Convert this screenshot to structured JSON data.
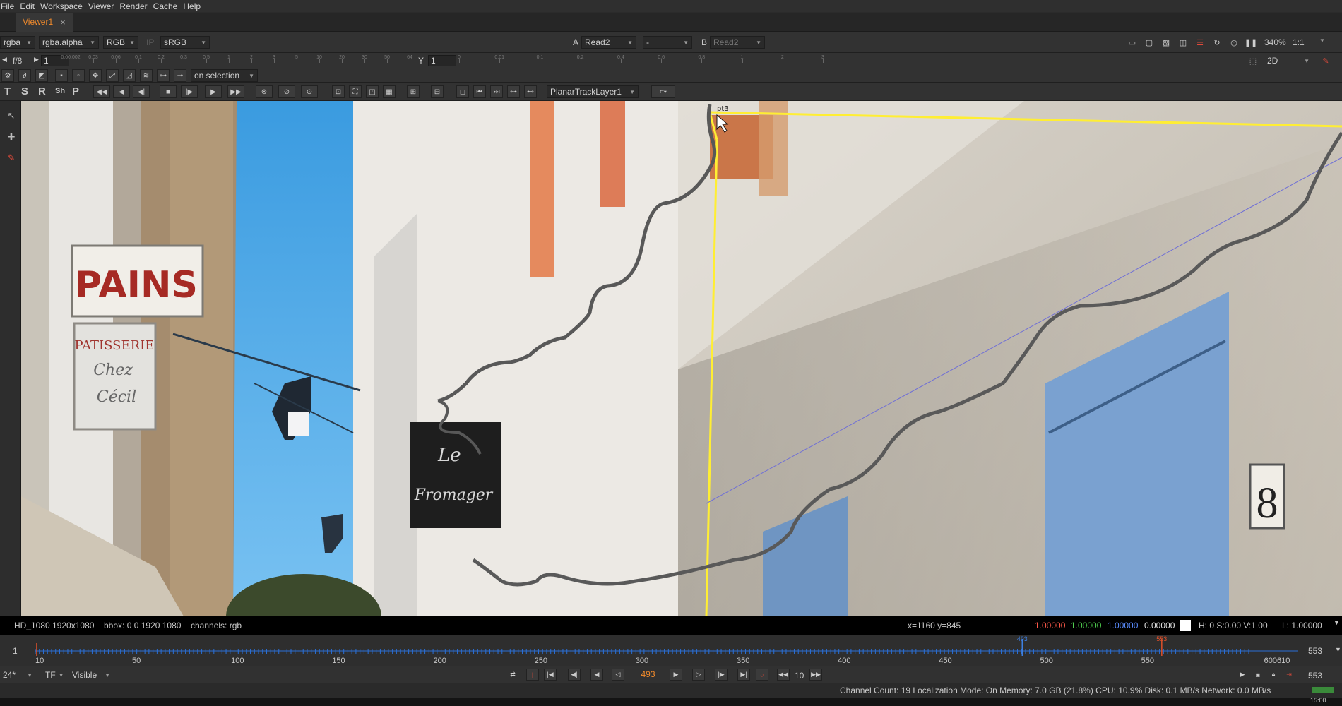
{
  "menu": [
    "File",
    "Edit",
    "Workspace",
    "Viewer",
    "Render",
    "Cache",
    "Help"
  ],
  "tab": {
    "label": "Viewer1",
    "close": "×"
  },
  "viewer_controls": {
    "channels": "rgba",
    "alpha_channel": "rgba.alpha",
    "display_channels": "RGB",
    "ip_label": "IP",
    "colorspace": "sRGB",
    "input_a_label": "A",
    "input_a": "Read2",
    "blend_mode": "-",
    "input_b_label": "B",
    "input_b": "Read2",
    "zoom": "340%",
    "proxy_ratio": "1:1"
  },
  "gain_gamma": {
    "fstop": "f/8",
    "gain_value": "1",
    "gain_ticks": [
      "0.00.002",
      "0.03",
      "0.06",
      "0.1",
      "0.2",
      "0.3",
      "0.5",
      "1",
      "2",
      "3",
      "5",
      "10",
      "20",
      "30",
      "50",
      "64"
    ],
    "gamma_label": "Y",
    "gamma_value": "1",
    "gamma_ticks": [
      "0",
      "0.01",
      "0.1",
      "0.2",
      "0.4",
      "0.6",
      "0.8",
      "1",
      "2",
      "3"
    ],
    "view_mode": "2D"
  },
  "tracker_toolbar": {
    "tool_letters": [
      "T",
      "S",
      "R",
      "Sh",
      "P"
    ],
    "update_mode": "on selection",
    "layer": "PlanarTrackLayer1"
  },
  "scene": {
    "sign_pains": "PAINS",
    "sign_patisserie": "PATISSERIE",
    "sign_chez": "Chez",
    "sign_cecil": "Cécil",
    "sign_le": "Le",
    "sign_fromager": "Fromager",
    "house_number": "8",
    "point_label": "pt3"
  },
  "info_bar": {
    "format": "HD_1080 1920x1080",
    "bbox": "bbox: 0 0 1920 1080",
    "channels": "channels: rgb",
    "coords": "x=1160 y=845",
    "r": "1.00000",
    "g": "1.00000",
    "b": "1.00000",
    "a": "0.00000",
    "hsv": "H:  0 S:0.00 V:1.00",
    "luminance": "L: 1.00000"
  },
  "timeline": {
    "start": "1",
    "end": "553",
    "range_start": "10",
    "range_end": "610",
    "ticks": [
      "10",
      "50",
      "100",
      "150",
      "200",
      "250",
      "300",
      "350",
      "400",
      "450",
      "500",
      "550",
      "600"
    ],
    "current_frame_marker": "493",
    "out_marker": "553",
    "current_fraction": 0.8133,
    "out_fraction": 0.9283
  },
  "playback": {
    "fps": "24*",
    "tf": "TF",
    "visible": "Visible",
    "current_frame": "493",
    "increment": "10",
    "end_frame": "553"
  },
  "status": {
    "text": "Channel Count: 19  Localization Mode: On  Memory: 7.0 GB (21.8%)  CPU: 10.9%  Disk: 0.1 MB/s  Network: 0.0 MB/s",
    "clock": "15:00"
  },
  "colors": {
    "accent": "#f08a2c",
    "track_line": "#ffee33",
    "spline": "#5a5a5a",
    "red_channel": "#ff5a4a",
    "green_channel": "#4fcf4f",
    "blue_channel": "#5a8cff"
  }
}
